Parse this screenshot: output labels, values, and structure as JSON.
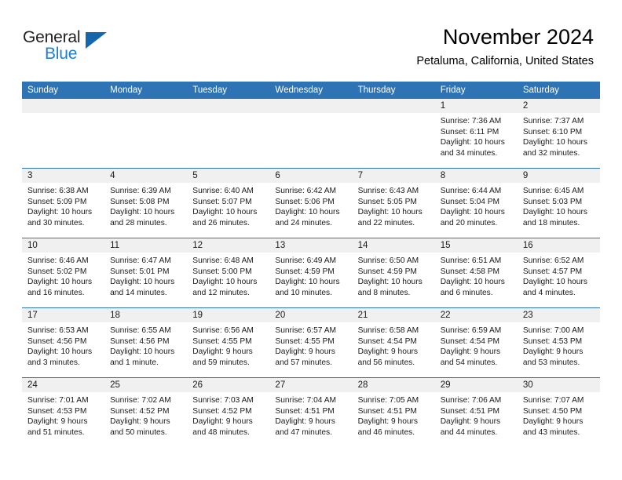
{
  "brand": {
    "name_part1": "General",
    "name_part2": "Blue",
    "triangle_icon": "triangle-icon",
    "accent_color": "#1b7fd4",
    "dark_color": "#231f20"
  },
  "header": {
    "month_title": "November 2024",
    "location": "Petaluma, California, United States"
  },
  "theme": {
    "header_blue": "#2e74b5",
    "date_band_gray": "#f0f0f0"
  },
  "calendar": {
    "weekday_headers": [
      "Sunday",
      "Monday",
      "Tuesday",
      "Wednesday",
      "Thursday",
      "Friday",
      "Saturday"
    ],
    "weeks": [
      [
        {
          "date": "",
          "empty": true
        },
        {
          "date": "",
          "empty": true
        },
        {
          "date": "",
          "empty": true
        },
        {
          "date": "",
          "empty": true
        },
        {
          "date": "",
          "empty": true
        },
        {
          "date": "1",
          "sunrise": "Sunrise: 7:36 AM",
          "sunset": "Sunset: 6:11 PM",
          "daylight1": "Daylight: 10 hours",
          "daylight2": "and 34 minutes."
        },
        {
          "date": "2",
          "sunrise": "Sunrise: 7:37 AM",
          "sunset": "Sunset: 6:10 PM",
          "daylight1": "Daylight: 10 hours",
          "daylight2": "and 32 minutes."
        }
      ],
      [
        {
          "date": "3",
          "sunrise": "Sunrise: 6:38 AM",
          "sunset": "Sunset: 5:09 PM",
          "daylight1": "Daylight: 10 hours",
          "daylight2": "and 30 minutes."
        },
        {
          "date": "4",
          "sunrise": "Sunrise: 6:39 AM",
          "sunset": "Sunset: 5:08 PM",
          "daylight1": "Daylight: 10 hours",
          "daylight2": "and 28 minutes."
        },
        {
          "date": "5",
          "sunrise": "Sunrise: 6:40 AM",
          "sunset": "Sunset: 5:07 PM",
          "daylight1": "Daylight: 10 hours",
          "daylight2": "and 26 minutes."
        },
        {
          "date": "6",
          "sunrise": "Sunrise: 6:42 AM",
          "sunset": "Sunset: 5:06 PM",
          "daylight1": "Daylight: 10 hours",
          "daylight2": "and 24 minutes."
        },
        {
          "date": "7",
          "sunrise": "Sunrise: 6:43 AM",
          "sunset": "Sunset: 5:05 PM",
          "daylight1": "Daylight: 10 hours",
          "daylight2": "and 22 minutes."
        },
        {
          "date": "8",
          "sunrise": "Sunrise: 6:44 AM",
          "sunset": "Sunset: 5:04 PM",
          "daylight1": "Daylight: 10 hours",
          "daylight2": "and 20 minutes."
        },
        {
          "date": "9",
          "sunrise": "Sunrise: 6:45 AM",
          "sunset": "Sunset: 5:03 PM",
          "daylight1": "Daylight: 10 hours",
          "daylight2": "and 18 minutes."
        }
      ],
      [
        {
          "date": "10",
          "sunrise": "Sunrise: 6:46 AM",
          "sunset": "Sunset: 5:02 PM",
          "daylight1": "Daylight: 10 hours",
          "daylight2": "and 16 minutes."
        },
        {
          "date": "11",
          "sunrise": "Sunrise: 6:47 AM",
          "sunset": "Sunset: 5:01 PM",
          "daylight1": "Daylight: 10 hours",
          "daylight2": "and 14 minutes."
        },
        {
          "date": "12",
          "sunrise": "Sunrise: 6:48 AM",
          "sunset": "Sunset: 5:00 PM",
          "daylight1": "Daylight: 10 hours",
          "daylight2": "and 12 minutes."
        },
        {
          "date": "13",
          "sunrise": "Sunrise: 6:49 AM",
          "sunset": "Sunset: 4:59 PM",
          "daylight1": "Daylight: 10 hours",
          "daylight2": "and 10 minutes."
        },
        {
          "date": "14",
          "sunrise": "Sunrise: 6:50 AM",
          "sunset": "Sunset: 4:59 PM",
          "daylight1": "Daylight: 10 hours",
          "daylight2": "and 8 minutes."
        },
        {
          "date": "15",
          "sunrise": "Sunrise: 6:51 AM",
          "sunset": "Sunset: 4:58 PM",
          "daylight1": "Daylight: 10 hours",
          "daylight2": "and 6 minutes."
        },
        {
          "date": "16",
          "sunrise": "Sunrise: 6:52 AM",
          "sunset": "Sunset: 4:57 PM",
          "daylight1": "Daylight: 10 hours",
          "daylight2": "and 4 minutes."
        }
      ],
      [
        {
          "date": "17",
          "sunrise": "Sunrise: 6:53 AM",
          "sunset": "Sunset: 4:56 PM",
          "daylight1": "Daylight: 10 hours",
          "daylight2": "and 3 minutes."
        },
        {
          "date": "18",
          "sunrise": "Sunrise: 6:55 AM",
          "sunset": "Sunset: 4:56 PM",
          "daylight1": "Daylight: 10 hours",
          "daylight2": "and 1 minute."
        },
        {
          "date": "19",
          "sunrise": "Sunrise: 6:56 AM",
          "sunset": "Sunset: 4:55 PM",
          "daylight1": "Daylight: 9 hours",
          "daylight2": "and 59 minutes."
        },
        {
          "date": "20",
          "sunrise": "Sunrise: 6:57 AM",
          "sunset": "Sunset: 4:55 PM",
          "daylight1": "Daylight: 9 hours",
          "daylight2": "and 57 minutes."
        },
        {
          "date": "21",
          "sunrise": "Sunrise: 6:58 AM",
          "sunset": "Sunset: 4:54 PM",
          "daylight1": "Daylight: 9 hours",
          "daylight2": "and 56 minutes."
        },
        {
          "date": "22",
          "sunrise": "Sunrise: 6:59 AM",
          "sunset": "Sunset: 4:54 PM",
          "daylight1": "Daylight: 9 hours",
          "daylight2": "and 54 minutes."
        },
        {
          "date": "23",
          "sunrise": "Sunrise: 7:00 AM",
          "sunset": "Sunset: 4:53 PM",
          "daylight1": "Daylight: 9 hours",
          "daylight2": "and 53 minutes."
        }
      ],
      [
        {
          "date": "24",
          "sunrise": "Sunrise: 7:01 AM",
          "sunset": "Sunset: 4:53 PM",
          "daylight1": "Daylight: 9 hours",
          "daylight2": "and 51 minutes."
        },
        {
          "date": "25",
          "sunrise": "Sunrise: 7:02 AM",
          "sunset": "Sunset: 4:52 PM",
          "daylight1": "Daylight: 9 hours",
          "daylight2": "and 50 minutes."
        },
        {
          "date": "26",
          "sunrise": "Sunrise: 7:03 AM",
          "sunset": "Sunset: 4:52 PM",
          "daylight1": "Daylight: 9 hours",
          "daylight2": "and 48 minutes."
        },
        {
          "date": "27",
          "sunrise": "Sunrise: 7:04 AM",
          "sunset": "Sunset: 4:51 PM",
          "daylight1": "Daylight: 9 hours",
          "daylight2": "and 47 minutes."
        },
        {
          "date": "28",
          "sunrise": "Sunrise: 7:05 AM",
          "sunset": "Sunset: 4:51 PM",
          "daylight1": "Daylight: 9 hours",
          "daylight2": "and 46 minutes."
        },
        {
          "date": "29",
          "sunrise": "Sunrise: 7:06 AM",
          "sunset": "Sunset: 4:51 PM",
          "daylight1": "Daylight: 9 hours",
          "daylight2": "and 44 minutes."
        },
        {
          "date": "30",
          "sunrise": "Sunrise: 7:07 AM",
          "sunset": "Sunset: 4:50 PM",
          "daylight1": "Daylight: 9 hours",
          "daylight2": "and 43 minutes."
        }
      ]
    ]
  }
}
